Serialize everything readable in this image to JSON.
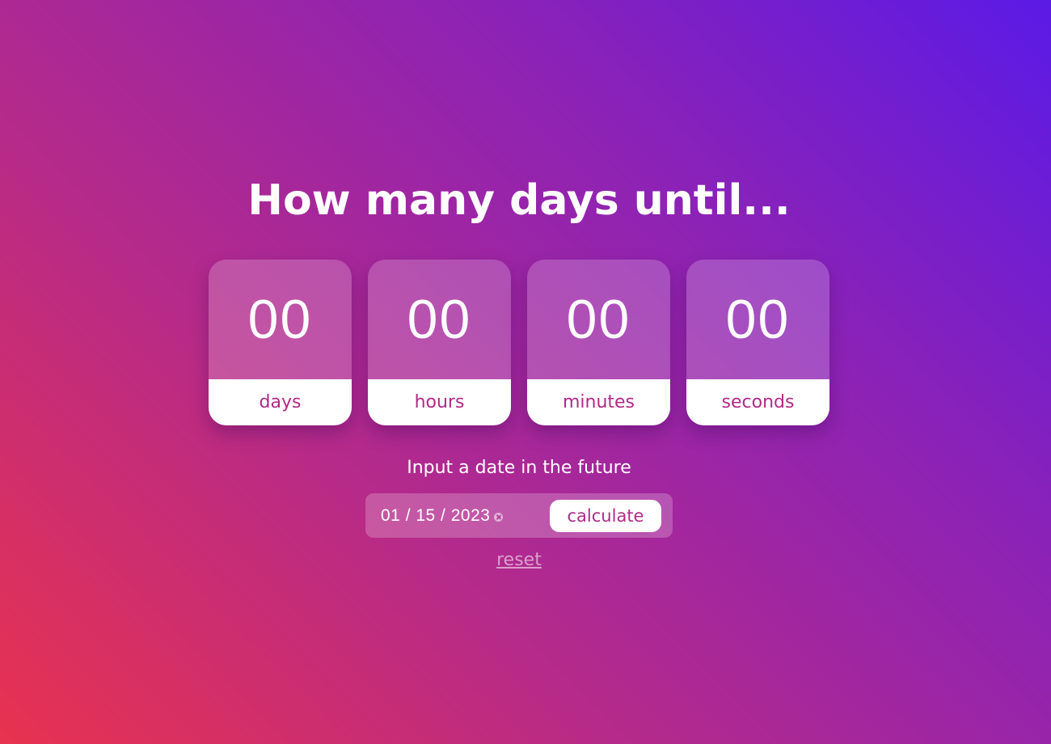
{
  "title": "How many days until...",
  "countdown": [
    {
      "value": "00",
      "label": "days"
    },
    {
      "value": "00",
      "label": "hours"
    },
    {
      "value": "00",
      "label": "minutes"
    },
    {
      "value": "00",
      "label": "seconds"
    }
  ],
  "form": {
    "prompt": "Input a date in the future",
    "date_value": "01 / 15 / 2023",
    "calculate_label": "calculate",
    "reset_label": "reset"
  },
  "colors": {
    "accent_text": "#b12a86",
    "gradient_start": "#e8324f",
    "gradient_end": "#5b1ae6"
  }
}
